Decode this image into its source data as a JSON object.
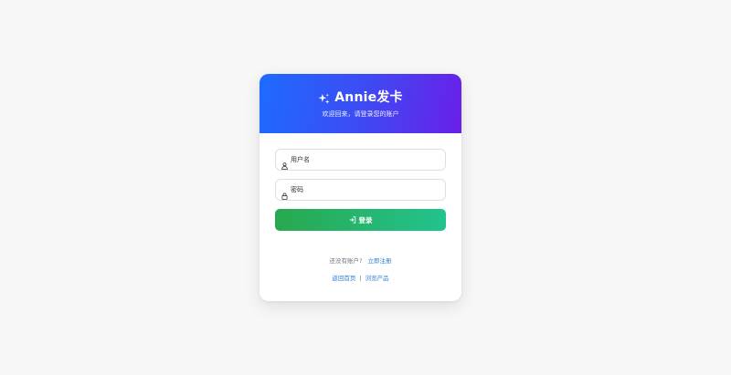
{
  "header": {
    "title": "Annie发卡",
    "subtitle": "欢迎回来，请登录您的账户",
    "sparkle_icon": "sparkles-icon",
    "gradient_start": "#1e6bff",
    "gradient_end": "#6a1fe8"
  },
  "form": {
    "username": {
      "placeholder": "用户名",
      "value": "",
      "icon": "user-icon"
    },
    "password": {
      "placeholder": "密码",
      "value": "",
      "icon": "lock-icon"
    },
    "login_button": {
      "label": "登录",
      "icon": "sign-in-icon",
      "color_start": "#28a84f",
      "color_end": "#22c38e"
    }
  },
  "footer": {
    "register_prompt": "还没有账户?",
    "register_link": "立即注册",
    "home_link": "返回首页",
    "separator": "|",
    "browse_link": "浏览产品",
    "link_color": "#2f7fd6"
  }
}
